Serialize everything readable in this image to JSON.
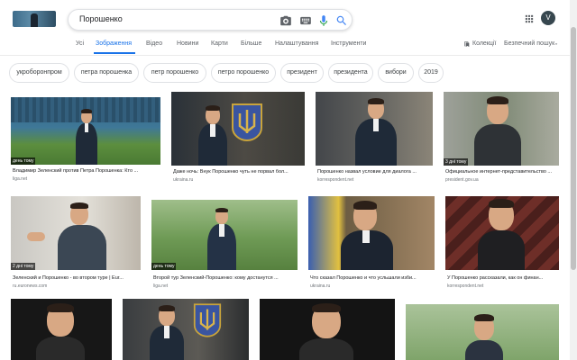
{
  "search": {
    "query": "Порошенко"
  },
  "avatar": {
    "letter": "V"
  },
  "tabs": [
    {
      "label": "Усі"
    },
    {
      "label": "Зображення"
    },
    {
      "label": "Відео"
    },
    {
      "label": "Новини"
    },
    {
      "label": "Карти"
    },
    {
      "label": "Більше"
    },
    {
      "label": "Налаштування"
    },
    {
      "label": "Інструменти"
    }
  ],
  "right_tools": {
    "collections": "Колекції",
    "safe_search": "Безпечний пошук"
  },
  "chips": [
    {
      "label": "укроборонпром"
    },
    {
      "label": "петра порошенка"
    },
    {
      "label": "петр порошенко"
    },
    {
      "label": "петро порошенко"
    },
    {
      "label": "президент"
    },
    {
      "label": "президента"
    },
    {
      "label": "вибори"
    },
    {
      "label": "2019"
    }
  ],
  "results": [
    {
      "badge": "день тому",
      "caption": "Владимир Зеленский против Петра Порошенка: Кто ...",
      "domain": "liga.net"
    },
    {
      "badge": "",
      "caption": "Даже ночь: Внук Порошенко чуть не порвал бол...",
      "domain": "ukraina.ru"
    },
    {
      "badge": "",
      "caption": "Порошенко назвал условие для диалога ...",
      "domain": "korrespondent.net"
    },
    {
      "badge": "3 дні тому",
      "caption": "Официальное интернет-представительство ...",
      "domain": "president.gov.ua"
    },
    {
      "badge": "2 дні тому",
      "caption": "Зеленский и Порошенко - во втором туре | Eur...",
      "domain": "ru.euronews.com"
    },
    {
      "badge": "день тому",
      "caption": "Второй тур Зеленский-Порошенко: кому достанутся ...",
      "domain": "liga.net"
    },
    {
      "badge": "",
      "caption": "Что сказал Порошенко и что усльшали изби...",
      "domain": "ukraina.ru"
    },
    {
      "badge": "",
      "caption": "У Порошенко рассказали, как он финан...",
      "domain": "korrespondent.net"
    },
    {
      "badge": "",
      "caption": "",
      "domain": ""
    },
    {
      "badge": "",
      "caption": "",
      "domain": ""
    },
    {
      "badge": "",
      "caption": "",
      "domain": ""
    },
    {
      "badge": "",
      "caption": "",
      "domain": ""
    }
  ]
}
